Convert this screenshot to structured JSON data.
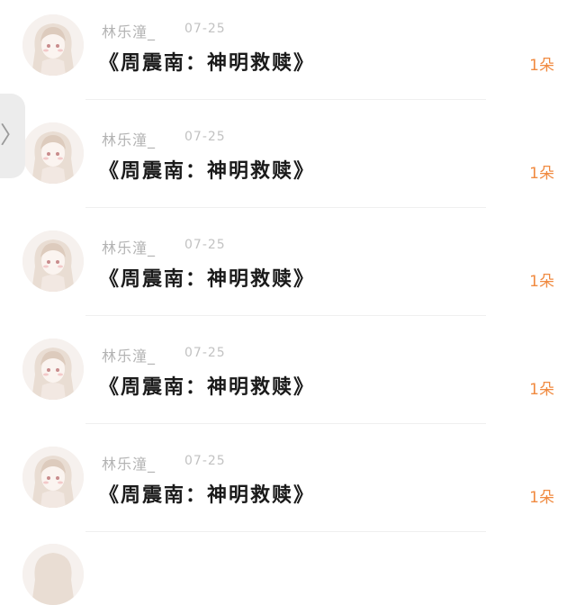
{
  "side_handle": {
    "icon": "chevron-right-icon",
    "glyph": "〉"
  },
  "posts": [
    {
      "user": "林乐潼_",
      "time": "07-25",
      "title": "《周震南：神明救赎》",
      "gift": "1朵"
    },
    {
      "user": "林乐潼_",
      "time": "07-25",
      "title": "《周震南：神明救赎》",
      "gift": "1朵"
    },
    {
      "user": "林乐潼_",
      "time": "07-25",
      "title": "《周震南：神明救赎》",
      "gift": "1朵"
    },
    {
      "user": "林乐潼_",
      "time": "07-25",
      "title": "《周震南：神明救赎》",
      "gift": "1朵"
    },
    {
      "user": "林乐潼_",
      "time": "07-25",
      "title": "《周震南：神明救赎》",
      "gift": "1朵"
    }
  ],
  "colors": {
    "accent": "#f08a40",
    "username": "#b3b3b3",
    "title": "#1a1a1a"
  }
}
